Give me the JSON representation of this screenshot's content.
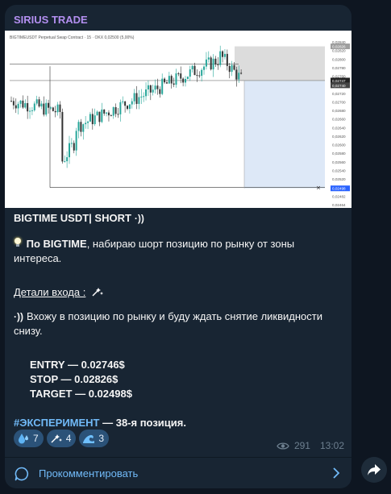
{
  "channel": {
    "name": "SIRIUS TRADE"
  },
  "chart": {
    "header": "BIGTIMEUSDT Perpetual Swap Contract · 15 · OKX  0,02500 (5,00%)",
    "price_ticks": [
      "0,02840",
      "0,02820",
      "0,02800",
      "0,02780",
      "0,02760",
      "0,02740",
      "0,02720",
      "0,02700",
      "0,02680",
      "0,02660",
      "0,02640",
      "0,02620",
      "0,02600",
      "0,02580",
      "0,02560",
      "0,02540",
      "0,02520",
      "0,02500",
      "0,02482",
      "0,02464"
    ],
    "price_labels": {
      "stop": "0,02826",
      "entry": "0,02747",
      "current": "0,02740",
      "target": "0,02498"
    },
    "colors": {
      "up": "#26a69a",
      "down": "#333333",
      "stop_zone": "#dcdcdc",
      "target_zone": "#dde8f7",
      "target_line": "#2962ff"
    }
  },
  "post": {
    "title": "BIGTIME USDT|  SHORT",
    "line1_bold": "По BIGTIME",
    "line1_rest": ", набираю шорт позицию по рынку от зоны интереса.",
    "details_label": "Детали входа :",
    "line2": "Вхожу в позицию по рынку и буду ждать снятие ликвидности снизу.",
    "entry": "ENTRY  — 0.02746$",
    "stop": "STOP —  0.02826$",
    "target": "TARGET — 0.02498$",
    "hashtag": "#ЭКСПЕРИМЕНТ",
    "position": " — 38-я   позиция."
  },
  "reactions": [
    {
      "icon": "drops-icon",
      "count": "7"
    },
    {
      "icon": "sparkle-icon",
      "count": "4"
    },
    {
      "icon": "wave-icon",
      "count": "3"
    }
  ],
  "meta": {
    "views": "291",
    "time": "13:02"
  },
  "comments": {
    "label": "Прокомментировать"
  }
}
